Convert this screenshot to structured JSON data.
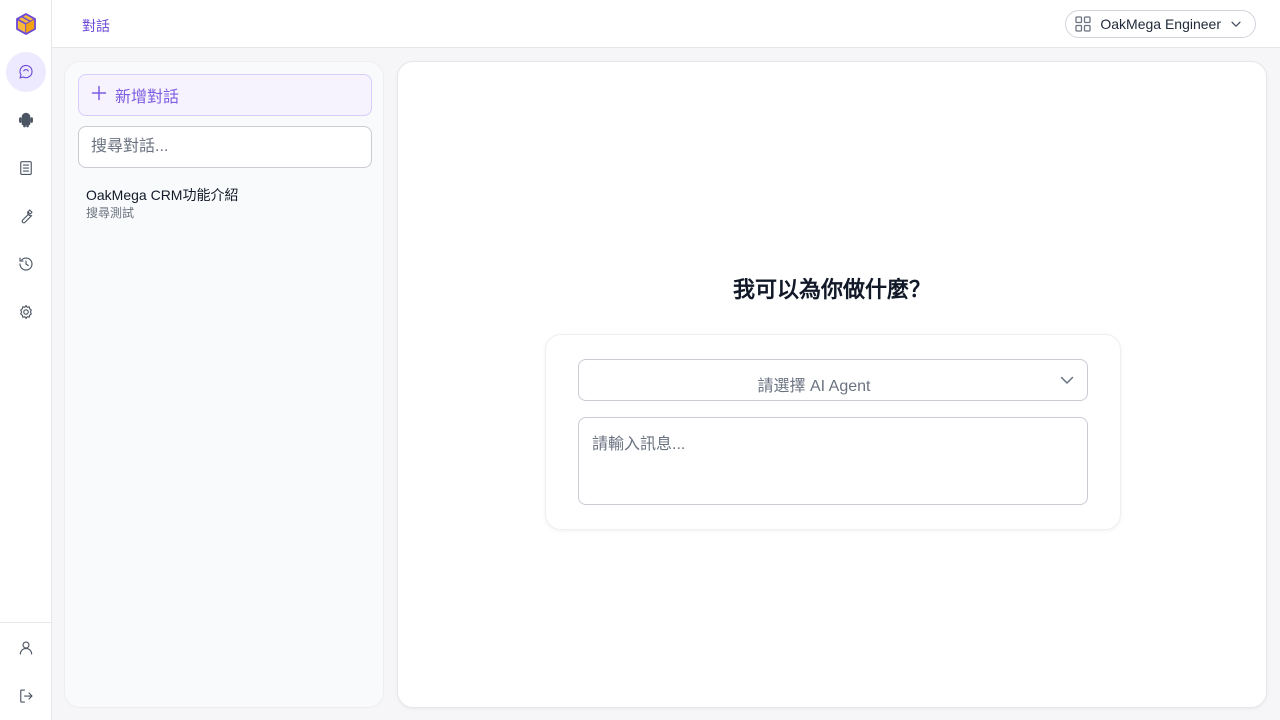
{
  "colors": {
    "accent": "#6d4ad8",
    "accent_light": "#ede9fe",
    "logo_orange": "#f59e0b",
    "logo_purple": "#6d4ad8"
  },
  "rail": {
    "logo_icon": "oakmega-cube-logo",
    "items": [
      {
        "icon": "chat-icon",
        "active": true
      },
      {
        "icon": "android-robot-icon",
        "active": false
      },
      {
        "icon": "document-icon",
        "active": false
      },
      {
        "icon": "wrench-icon",
        "active": false
      },
      {
        "icon": "history-icon",
        "active": false
      },
      {
        "icon": "gear-icon",
        "active": false
      }
    ],
    "bottom_items": [
      {
        "icon": "user-icon"
      },
      {
        "icon": "logout-icon"
      }
    ]
  },
  "header": {
    "breadcrumb": "對話",
    "org_switcher": {
      "icon": "grid-icon",
      "label": "OakMega Engineer"
    }
  },
  "sidebar": {
    "new_conversation_label": "新增對話",
    "search_placeholder": "搜尋對話...",
    "conversations": [
      {
        "title": "OakMega CRM功能介紹",
        "subtitle": "搜尋測試"
      }
    ]
  },
  "main": {
    "headline": "我可以為你做什麼？",
    "agent_select_placeholder": "請選擇 AI Agent",
    "message_placeholder": "請輸入訊息..."
  }
}
